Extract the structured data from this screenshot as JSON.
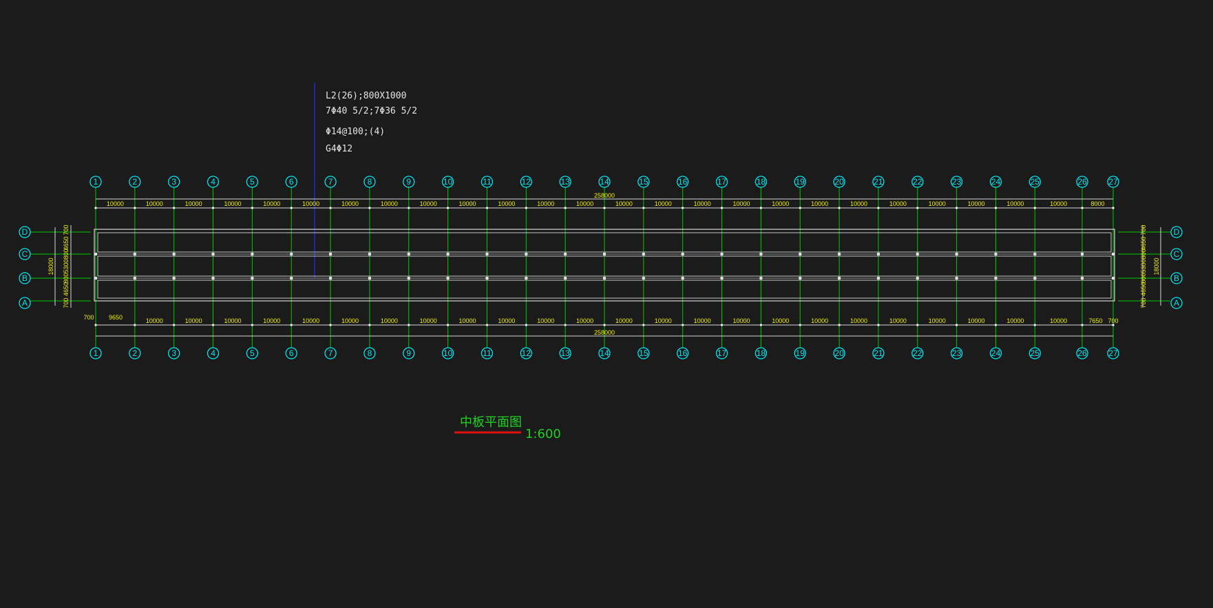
{
  "annotation": {
    "lines": [
      "L2(26);800X1000",
      "7Φ40 5/2;7Φ36 5/2",
      "Φ14@100;(4)",
      "G4Φ12"
    ]
  },
  "axes": {
    "column_labels": [
      "1",
      "2",
      "3",
      "4",
      "5",
      "6",
      "7",
      "8",
      "9",
      "10",
      "11",
      "12",
      "13",
      "14",
      "15",
      "16",
      "17",
      "18",
      "19",
      "20",
      "21",
      "22",
      "23",
      "24",
      "25",
      "26",
      "27"
    ],
    "row_labels": [
      "D",
      "C",
      "B",
      "A"
    ]
  },
  "dimensions": {
    "top_segments": [
      "10000",
      "10000",
      "10000",
      "10000",
      "10000",
      "10000",
      "10000",
      "10000",
      "10000",
      "10000",
      "10000",
      "10000",
      "10000",
      "10000",
      "10000",
      "10000",
      "10000",
      "10000",
      "10000",
      "10000",
      "10000",
      "10000",
      "10000",
      "10000",
      "10000",
      "8000"
    ],
    "top_total": "258000",
    "bottom_segments": [
      "700",
      "9650",
      "10000",
      "10000",
      "10000",
      "10000",
      "10000",
      "10000",
      "10000",
      "10000",
      "10000",
      "10000",
      "10000",
      "10000",
      "10000",
      "10000",
      "10000",
      "10000",
      "10000",
      "10000",
      "10000",
      "10000",
      "10000",
      "10000",
      "10000",
      "10000",
      "7650",
      "700"
    ],
    "bottom_total": "258000",
    "left_segments": [
      "700",
      "4650",
      "800",
      "5300",
      "800",
      "4650",
      "700"
    ],
    "left_total": "18000",
    "right_segments": [
      "700",
      "4650",
      "800",
      "5300",
      "800",
      "4650",
      "700"
    ],
    "right_total": "18000"
  },
  "drawing": {
    "title": "中板平面图",
    "scale": "1:600"
  },
  "colors": {
    "background": "#1b1b1b",
    "axis_bubble": "#00e5f0",
    "grid_line": "#00c800",
    "dimension_text": "#f0f000",
    "outline": "#d8d8d8",
    "leader": "#1a2ecc",
    "title": "#20d020",
    "title_underline": "#e01010"
  }
}
